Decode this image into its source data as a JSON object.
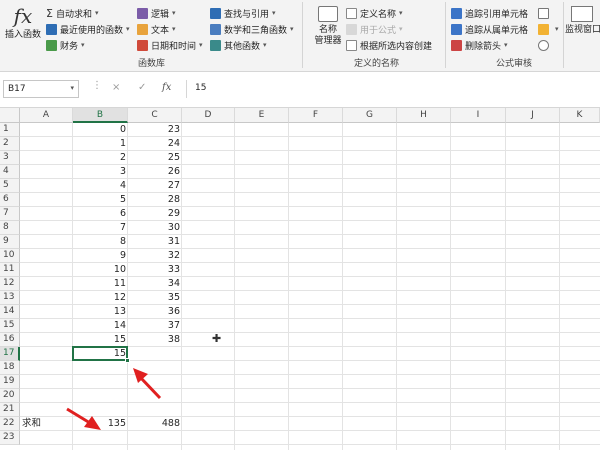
{
  "ribbon": {
    "insert_function": {
      "icon": "fx",
      "label": "插入函数"
    },
    "library": {
      "col1": [
        "自动求和",
        "最近使用的函数",
        "财务"
      ],
      "col2": [
        "逻辑",
        "文本",
        "日期和时间"
      ],
      "col3": [
        "查找与引用",
        "数学和三角函数",
        "其他函数"
      ],
      "group_label": "函数库"
    },
    "names": {
      "manager_line1": "名称",
      "manager_line2": "管理器",
      "items": [
        "定义名称",
        "用于公式",
        "根据所选内容创建"
      ],
      "group_label": "定义的名称"
    },
    "audit": {
      "items": [
        "追踪引用单元格",
        "追踪从属单元格",
        "删除箭头"
      ],
      "group_label": "公式审核"
    },
    "watch_window": "监视窗口"
  },
  "formula_bar": {
    "name_box": "B17",
    "cancel_icon": "×",
    "enter_icon": "✓",
    "fx_icon": "fx",
    "value": "15"
  },
  "grid": {
    "columns": [
      "A",
      "B",
      "C",
      "D",
      "E",
      "F",
      "G",
      "H",
      "I",
      "J",
      "K"
    ],
    "selected_column": "B",
    "selected_row": "17",
    "rows": [
      "1",
      "2",
      "3",
      "4",
      "5",
      "6",
      "7",
      "8",
      "9",
      "10",
      "11",
      "12",
      "13",
      "14",
      "15",
      "16",
      "17",
      "18",
      "19",
      "20",
      "21",
      "22",
      "23"
    ],
    "col_b": [
      "0",
      "1",
      "2",
      "3",
      "4",
      "5",
      "6",
      "7",
      "8",
      "9",
      "10",
      "11",
      "12",
      "13",
      "14",
      "15",
      "15"
    ],
    "col_c": [
      "23",
      "24",
      "25",
      "26",
      "27",
      "28",
      "29",
      "30",
      "31",
      "32",
      "33",
      "34",
      "35",
      "36",
      "37",
      "38"
    ],
    "sum_label": "求和",
    "sum_b": "135",
    "sum_c": "488"
  },
  "colors": {
    "accent": "#217346",
    "arrow": "#e02020"
  }
}
